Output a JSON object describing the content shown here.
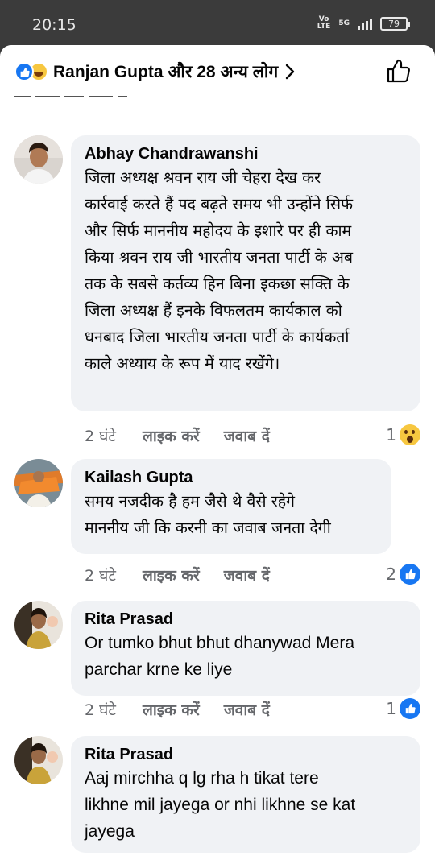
{
  "status_bar": {
    "time": "20:15",
    "volte": "Vo\nLTE",
    "network": "5G",
    "battery": "79"
  },
  "header": {
    "reaction_icons": [
      "like-icon",
      "haha-icon"
    ],
    "title": "Ranjan Gupta और 28 अन्य लोग",
    "chevron": "chevron-right-icon",
    "like_button_icon": "thumbs-up-outline-icon"
  },
  "comments": [
    {
      "author": "Abhay Chandrawanshi",
      "text": "जिला अध्यक्ष श्रवन राय जी चेहरा देख कर\nकार्रवाई करते हैं पद बढ़ते समय भी उन्होंने सिर्फ\nऔर सिर्फ माननीय महोदय के इशारे पर ही काम\nकिया श्रवन राय जी भारतीय जनता पार्टी के अब\nतक के सबसे कर्तव्य हिन बिना इकछा सक्ति के\nजिला अध्यक्ष हैं इनके विफलतम कार्यकाल को\nधनबाद जिला भारतीय जनता पार्टी के कार्यकर्ता\nकाले अध्याय के रूप में याद रखेंगे।",
      "time": "2 घंटे",
      "like_label": "लाइक करें",
      "reply_label": "जवाब दें",
      "reaction_count": "1",
      "reaction_icon": "wow-icon"
    },
    {
      "author": "Kailash Gupta",
      "text": "समय नजदीक है हम जैसे थे वैसे रहेगे\nमाननीय जी कि करनी का जवाब जनता देगी",
      "time": "2 घंटे",
      "like_label": "लाइक करें",
      "reply_label": "जवाब दें",
      "reaction_count": "2",
      "reaction_icon": "like-icon"
    },
    {
      "author": "Rita Prasad",
      "text": "Or tumko bhut bhut dhanywad Mera\nparchar krne ke liye",
      "time": "2 घंटे",
      "like_label": "लाइक करें",
      "reply_label": "जवाब दें",
      "reaction_count": "1",
      "reaction_icon": "like-icon"
    },
    {
      "author": "Rita Prasad",
      "text": "Aaj mirchha q lg rha h tikat tere\nlikhne mil jayega or nhi likhne se kat\njayega"
    }
  ]
}
